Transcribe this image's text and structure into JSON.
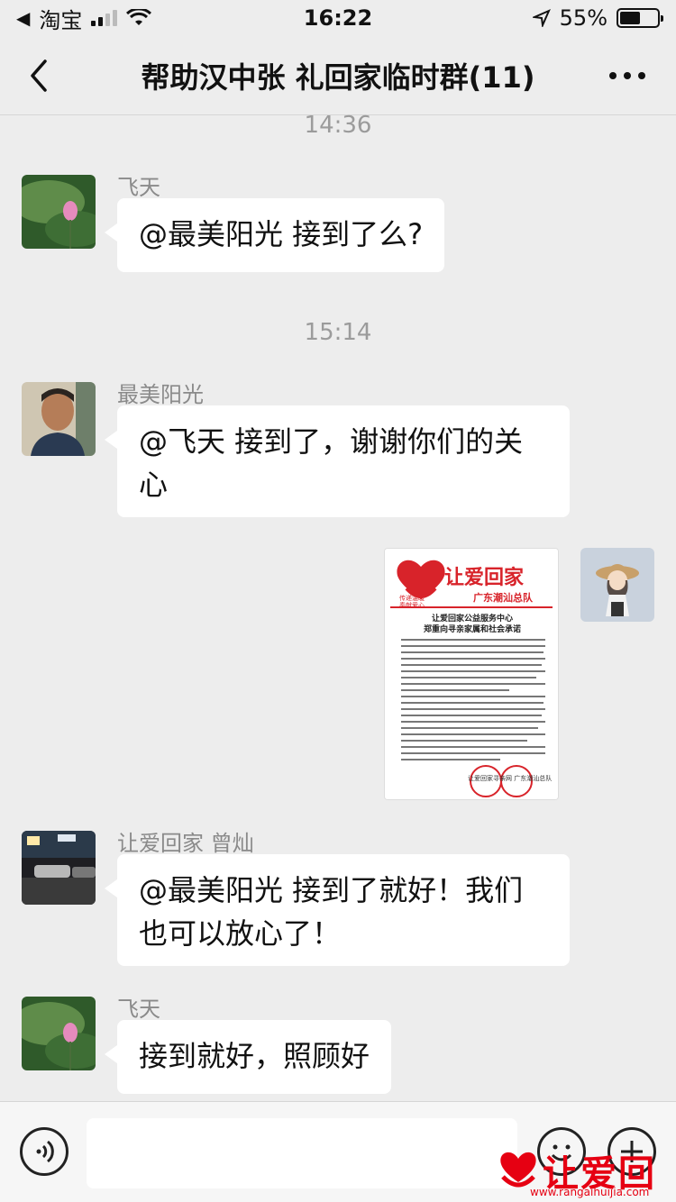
{
  "status_bar": {
    "back_app": "淘宝",
    "time": "16:22",
    "battery": "55%",
    "battery_level": 0.55
  },
  "header": {
    "title": "帮助汉中张 礼回家临时群(11)"
  },
  "messages": [
    {
      "time": "14:36"
    },
    {
      "sender": "飞天",
      "text": "@最美阳光 接到了么?"
    },
    {
      "time": "15:14"
    },
    {
      "sender": "最美阳光",
      "text": "@飞天 接到了，谢谢你们的关心"
    },
    {
      "image": {
        "brand": "让爱回家",
        "slogan1": "传递温暖",
        "slogan2": "奉献爱心",
        "team": "广东潮汕总队",
        "heading1": "让爱回家公益服务中心",
        "heading2": "郑重向寻亲家属和社会承诺",
        "stamp_text": "让爱回家寻亲网 广东潮汕总队"
      }
    },
    {
      "sender": "让爱回家 曾灿",
      "text": "@最美阳光 接到了就好！我们也可以放心了！"
    },
    {
      "sender": "飞天",
      "text": "接到就好，照顾好"
    }
  ],
  "input_bar": {
    "placeholder": ""
  },
  "watermark": {
    "text": "让爱回家",
    "url": "www.rangaihuijia.com"
  }
}
